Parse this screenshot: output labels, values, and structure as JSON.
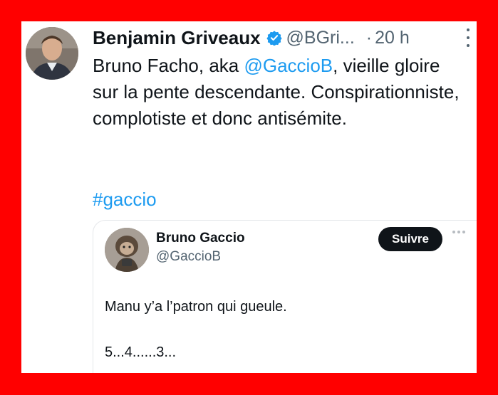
{
  "tweet": {
    "author_name": "Benjamin Griveaux",
    "author_handle": "@BGri...",
    "separator": "·",
    "time": "20 h",
    "text_before": "Bruno Facho, aka ",
    "mention": "@GaccioB",
    "text_after": ", vieille gloire sur la pente descendante. Conspirationniste, complotiste et donc antisémite.",
    "hashtag": "#gaccio"
  },
  "quoted": {
    "author_name": "Bruno Gaccio",
    "author_handle": "@GaccioB",
    "follow_label": "Suivre",
    "text": "Manu y’a l’patron qui gueule.",
    "countdown": "5...4......3..."
  },
  "colors": {
    "frame": "#ff0000",
    "accent": "#1d9bf0",
    "text": "#0f1419",
    "muted": "#536471"
  },
  "icons": [
    "verified-badge-icon",
    "more-options-icon",
    "quote-more-options-icon"
  ]
}
